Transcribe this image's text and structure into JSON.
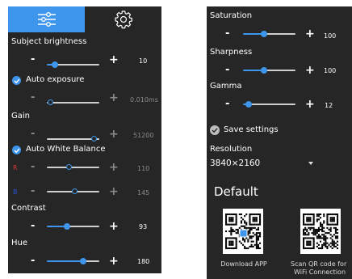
{
  "left": {
    "tabs": [
      {
        "icon": "sliders-icon",
        "active": true
      },
      {
        "icon": "gear-icon",
        "active": false
      }
    ],
    "subject_brightness": {
      "label": "Subject brightness",
      "value": "10",
      "level": 0.1
    },
    "auto_exposure": {
      "label": "Auto exposure",
      "checked": true
    },
    "exposure": {
      "value": "0.010ms",
      "level": 0.02
    },
    "gain": {
      "label": "Gain",
      "value": "51200",
      "level": 0.97
    },
    "auto_white_balance": {
      "label": "Auto White Balance",
      "checked": true
    },
    "wb_r": {
      "channel": "R",
      "value": "110",
      "level": 0.42
    },
    "wb_b": {
      "channel": "B",
      "value": "145",
      "level": 0.55
    },
    "contrast": {
      "label": "Contrast",
      "value": "93",
      "level": 0.36
    },
    "hue": {
      "label": "Hue",
      "value": "180",
      "level": 0.72
    }
  },
  "right": {
    "saturation": {
      "label": "Saturation",
      "value": "100",
      "level": 0.39
    },
    "sharpness": {
      "label": "Sharpness",
      "value": "100",
      "level": 0.39
    },
    "gamma": {
      "label": "Gamma",
      "value": "12",
      "level": 0.05
    },
    "save_settings": {
      "label": "Save settings",
      "checked": true
    },
    "resolution": {
      "label": "Resolution",
      "selected": "3840×2160"
    },
    "default_label": "Default",
    "qr_download": {
      "caption": "Download APP"
    },
    "qr_wifi": {
      "caption_line1": "Scan QR code for",
      "caption_line2": "WiFi Connection"
    }
  },
  "colors": {
    "accent": "#3d95ec",
    "panel_bg": "#262626",
    "track_inactive": "#cfcfcf",
    "red_channel": "#d83a3a",
    "blue_channel": "#2b55d6",
    "disabled": "#8a8a8a"
  }
}
